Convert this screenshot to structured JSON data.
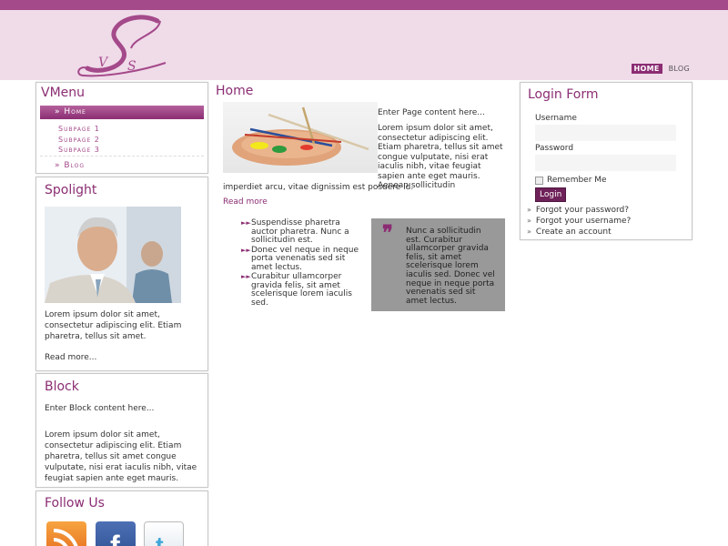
{
  "header": {
    "logo_text": "VS",
    "nav": [
      {
        "label": "HOME",
        "active": true
      },
      {
        "label": "BLOG",
        "active": false
      }
    ]
  },
  "vmenu": {
    "title": "VMenu",
    "active_item": "» Home",
    "subpages": [
      "Subpage 1",
      "Subpage 2",
      "Subpage 3"
    ],
    "blog": "» Blog"
  },
  "spotlight": {
    "title": "Spolight",
    "text": "Lorem ipsum dolor sit amet, consectetur adipiscing elit. Etiam pharetra, tellus sit amet.",
    "read_more": "Read more..."
  },
  "block": {
    "title": "Block",
    "intro": "Enter Block content here...",
    "text": "Lorem ipsum dolor sit amet, consectetur adipiscing elit. Etiam pharetra, tellus sit amet congue vulputate, nisi erat iaculis nibh, vitae feugiat sapien ante eget mauris."
  },
  "follow": {
    "title": "Follow Us",
    "icons": [
      "rss-icon",
      "facebook-icon",
      "twitter-icon"
    ]
  },
  "main": {
    "title": "Home",
    "enter_text": "Enter Page content here...",
    "paragraph": "Lorem ipsum dolor sit amet, consectetur adipiscing elit. Etiam pharetra, tellus sit amet congue vulputate, nisi erat iaculis nibh, vitae feugiat sapien ante eget mauris. Aenean sollicitudin",
    "paragraph_cont": "imperdiet arcu, vitae dignissim est posuere id.",
    "read_more": "Read more",
    "bullets": [
      "Suspendisse pharetra auctor pharetra. Nunc a sollicitudin est.",
      "Donec vel neque in neque porta venenatis sed sit amet lectus.",
      "Curabitur ullamcorper gravida felis, sit amet scelerisque lorem iaculis sed."
    ],
    "quote": "Nunc a sollicitudin est. Curabitur ullamcorper gravida felis, sit amet scelerisque lorem iaculis sed. Donec vel neque in neque porta venenatis sed sit amet lectus."
  },
  "login": {
    "title": "Login Form",
    "username_label": "Username",
    "password_label": "Password",
    "remember_label": "Remember Me",
    "button": "Login",
    "links": [
      "Forgot your password?",
      "Forgot your username?",
      "Create an account"
    ]
  },
  "colors": {
    "accent": "#8b2d73",
    "topbar": "#a4498a",
    "header_bg": "#f0dbe9",
    "quote_bg": "#999999"
  }
}
